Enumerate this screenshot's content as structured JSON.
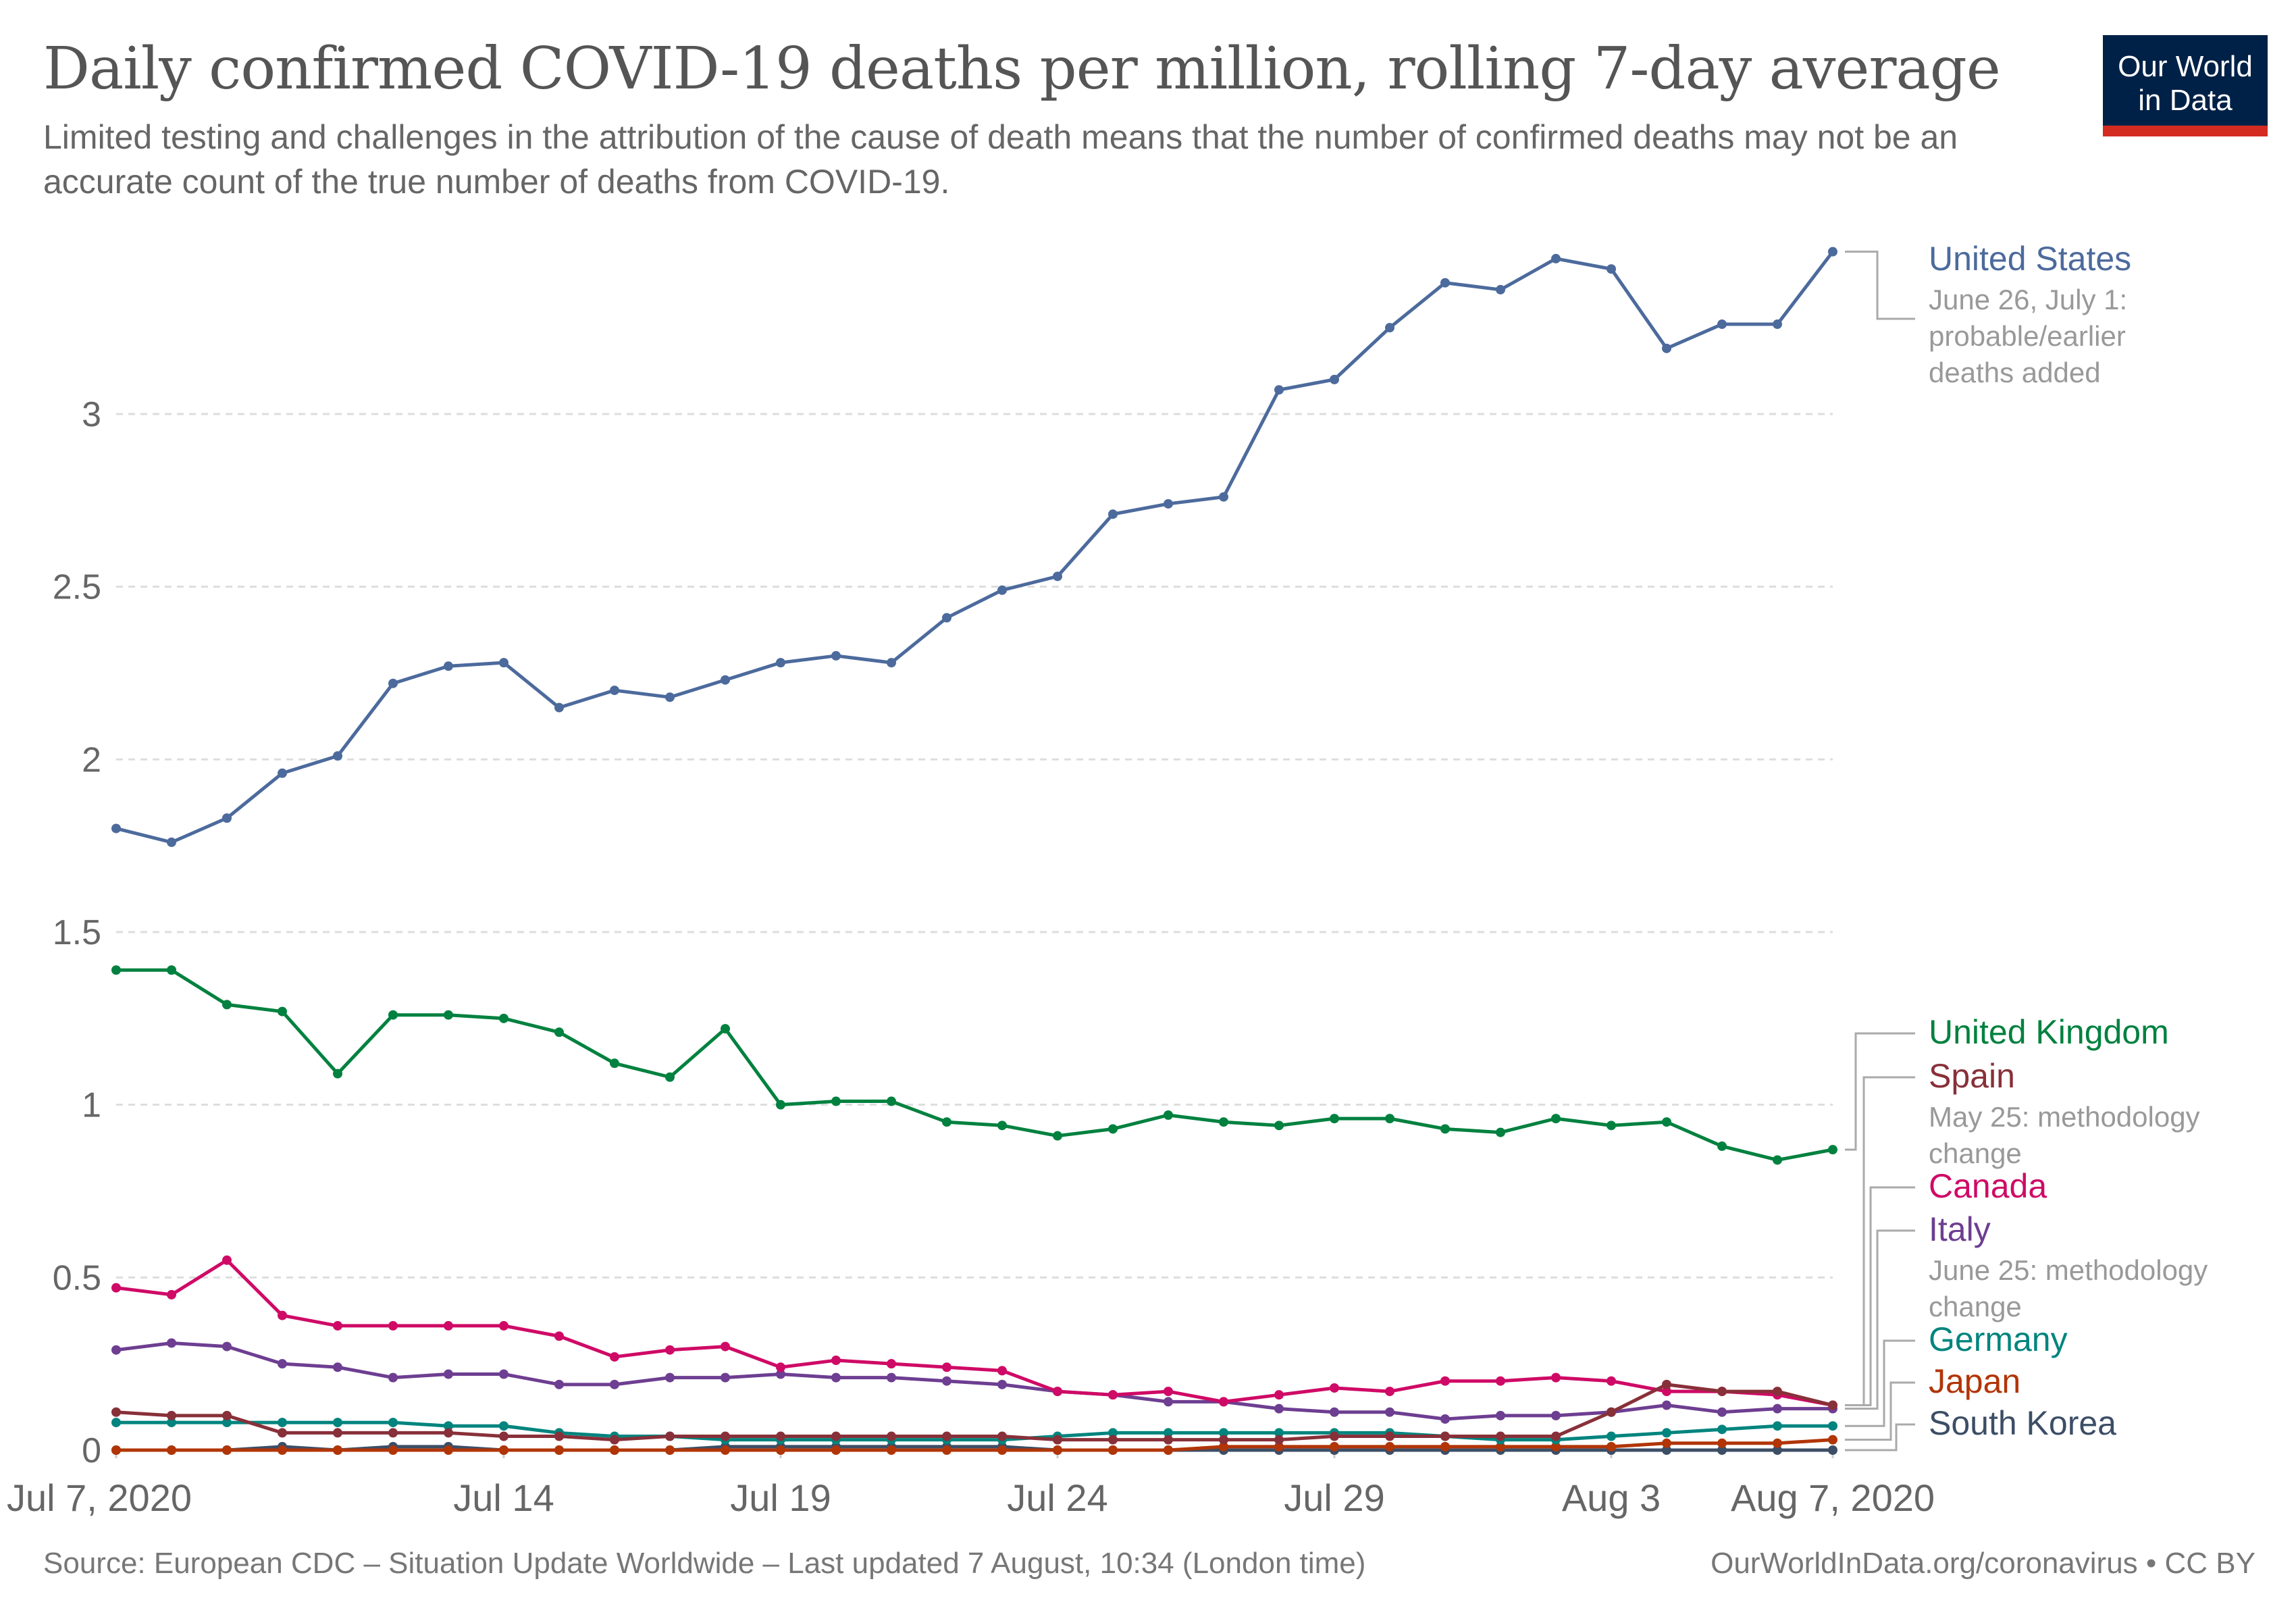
{
  "header": {
    "title": "Daily confirmed COVID-19 deaths per million, rolling 7-day average",
    "subtitle": "Limited testing and challenges in the attribution of the cause of death means that the number of confirmed deaths may not be an accurate count of the true number of deaths from COVID-19.",
    "logo_line1": "Our World",
    "logo_line2": "in Data"
  },
  "footer": {
    "source": "Source: European CDC – Situation Update Worldwide – Last updated 7 August, 10:34 (London time)",
    "license": "OurWorldInData.org/coronavirus • CC BY"
  },
  "colors": {
    "logo_bg": "#002147",
    "logo_accent": "#d42b21"
  },
  "chart_data": {
    "type": "line",
    "title": "Daily confirmed COVID-19 deaths per million, rolling 7-day average",
    "xlabel": "",
    "ylabel": "",
    "ylim": [
      0,
      3.5
    ],
    "yticks": [
      0,
      0.5,
      1,
      1.5,
      2,
      2.5,
      3
    ],
    "ytick_labels": [
      "0",
      "0.5",
      "1",
      "1.5",
      "2",
      "2.5",
      "3"
    ],
    "grid": true,
    "legend": "right",
    "x": [
      "Jul 7",
      "Jul 8",
      "Jul 9",
      "Jul 10",
      "Jul 11",
      "Jul 12",
      "Jul 13",
      "Jul 14",
      "Jul 15",
      "Jul 16",
      "Jul 17",
      "Jul 18",
      "Jul 19",
      "Jul 20",
      "Jul 21",
      "Jul 22",
      "Jul 23",
      "Jul 24",
      "Jul 25",
      "Jul 26",
      "Jul 27",
      "Jul 28",
      "Jul 29",
      "Jul 30",
      "Jul 31",
      "Aug 1",
      "Aug 2",
      "Aug 3",
      "Aug 4",
      "Aug 5",
      "Aug 6",
      "Aug 7"
    ],
    "xticks": [
      {
        "index": 0,
        "label": "Jul 7, 2020"
      },
      {
        "index": 7,
        "label": "Jul 14"
      },
      {
        "index": 12,
        "label": "Jul 19"
      },
      {
        "index": 17,
        "label": "Jul 24"
      },
      {
        "index": 22,
        "label": "Jul 29"
      },
      {
        "index": 27,
        "label": "Aug 3"
      },
      {
        "index": 31,
        "label": "Aug 7, 2020"
      }
    ],
    "series": [
      {
        "name": "United States",
        "color": "#4c6a9c",
        "note": "June 26, July 1: probable/earlier deaths added",
        "values": [
          1.8,
          1.76,
          1.83,
          1.96,
          2.01,
          2.22,
          2.27,
          2.28,
          2.15,
          2.2,
          2.18,
          2.23,
          2.28,
          2.3,
          2.28,
          2.41,
          2.49,
          2.53,
          2.71,
          2.74,
          2.76,
          3.07,
          3.1,
          3.25,
          3.38,
          3.36,
          3.45,
          3.42,
          3.19,
          3.26,
          3.26,
          3.47
        ]
      },
      {
        "name": "United Kingdom",
        "color": "#00813f",
        "values": [
          1.39,
          1.39,
          1.29,
          1.27,
          1.09,
          1.26,
          1.26,
          1.25,
          1.21,
          1.12,
          1.08,
          1.22,
          1.0,
          1.01,
          1.01,
          0.95,
          0.94,
          0.91,
          0.93,
          0.97,
          0.95,
          0.94,
          0.96,
          0.96,
          0.93,
          0.92,
          0.96,
          0.94,
          0.95,
          0.88,
          0.84,
          0.87
        ]
      },
      {
        "name": "Spain",
        "color": "#883039",
        "note": "May 25: methodology change",
        "values": [
          0.11,
          0.1,
          0.1,
          0.05,
          0.05,
          0.05,
          0.05,
          0.04,
          0.04,
          0.03,
          0.04,
          0.04,
          0.04,
          0.04,
          0.04,
          0.04,
          0.04,
          0.03,
          0.03,
          0.03,
          0.03,
          0.03,
          0.04,
          0.04,
          0.04,
          0.04,
          0.04,
          0.11,
          0.19,
          0.17,
          0.17,
          0.13
        ]
      },
      {
        "name": "Canada",
        "color": "#cf0a66",
        "values": [
          0.47,
          0.45,
          0.55,
          0.39,
          0.36,
          0.36,
          0.36,
          0.36,
          0.33,
          0.27,
          0.29,
          0.3,
          0.24,
          0.26,
          0.25,
          0.24,
          0.23,
          0.17,
          0.16,
          0.17,
          0.14,
          0.16,
          0.18,
          0.17,
          0.2,
          0.2,
          0.21,
          0.2,
          0.17,
          0.17,
          0.16,
          0.13
        ]
      },
      {
        "name": "Italy",
        "color": "#6d3e91",
        "note": "June 25: methodology change",
        "values": [
          0.29,
          0.31,
          0.3,
          0.25,
          0.24,
          0.21,
          0.22,
          0.22,
          0.19,
          0.19,
          0.21,
          0.21,
          0.22,
          0.21,
          0.21,
          0.2,
          0.19,
          0.17,
          0.16,
          0.14,
          0.14,
          0.12,
          0.11,
          0.11,
          0.09,
          0.1,
          0.1,
          0.11,
          0.13,
          0.11,
          0.12,
          0.12
        ]
      },
      {
        "name": "Germany",
        "color": "#00847e",
        "values": [
          0.08,
          0.08,
          0.08,
          0.08,
          0.08,
          0.08,
          0.07,
          0.07,
          0.05,
          0.04,
          0.04,
          0.03,
          0.03,
          0.03,
          0.03,
          0.03,
          0.03,
          0.04,
          0.05,
          0.05,
          0.05,
          0.05,
          0.05,
          0.05,
          0.04,
          0.03,
          0.03,
          0.04,
          0.05,
          0.06,
          0.07,
          0.07
        ]
      },
      {
        "name": "Japan",
        "color": "#b13507",
        "values": [
          0.0,
          0.0,
          0.0,
          0.0,
          0.0,
          0.0,
          0.0,
          0.0,
          0.0,
          0.0,
          0.0,
          0.0,
          0.0,
          0.0,
          0.0,
          0.0,
          0.0,
          0.0,
          0.0,
          0.0,
          0.01,
          0.01,
          0.01,
          0.01,
          0.01,
          0.01,
          0.01,
          0.01,
          0.02,
          0.02,
          0.02,
          0.03
        ]
      },
      {
        "name": "South Korea",
        "color": "#3c4e66",
        "values": [
          0.0,
          0.0,
          0.0,
          0.01,
          0.0,
          0.01,
          0.01,
          0.0,
          0.0,
          0.0,
          0.0,
          0.01,
          0.01,
          0.01,
          0.01,
          0.01,
          0.01,
          0.0,
          0.0,
          0.0,
          0.0,
          0.0,
          0.0,
          0.0,
          0.0,
          0.0,
          0.0,
          0.0,
          0.0,
          0.0,
          0.0,
          0.0
        ]
      }
    ],
    "legend_entries": [
      {
        "name": "United States",
        "note": "June 26, July 1: probable/earlier deaths added"
      },
      {
        "name": "United Kingdom",
        "note": ""
      },
      {
        "name": "Spain",
        "note": "May 25: methodology change"
      },
      {
        "name": "Canada",
        "note": ""
      },
      {
        "name": "Italy",
        "note": "June 25: methodology change"
      },
      {
        "name": "Germany",
        "note": ""
      },
      {
        "name": "Japan",
        "note": ""
      },
      {
        "name": "South Korea",
        "note": ""
      }
    ]
  }
}
